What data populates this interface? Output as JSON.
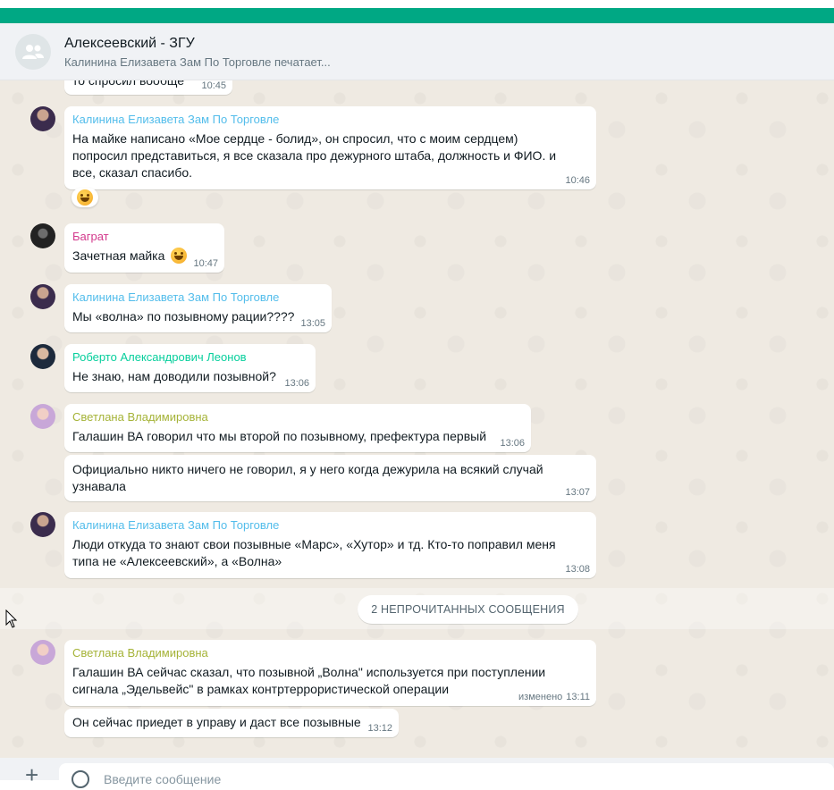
{
  "header": {
    "title": "Алексеевский - ЗГУ",
    "status": "Калинина Елизавета Зам По Торговле печатает..."
  },
  "colors": {
    "brand": "#00a884",
    "sender_kalinina": "#53bdeb",
    "sender_bagrat": "#d3398c",
    "sender_leonov": "#06cf9c",
    "sender_svetlana": "#a5b337"
  },
  "messages": [
    {
      "text": "то спросил вообще",
      "time": "10:45"
    },
    {
      "sender": "Калинина Елизавета Зам По Торговле",
      "text": "На майке написано «Мое сердце - болид», он спросил, что с моим сердцем) попросил представиться, я все сказала про дежурного штаба, должность и ФИО. и все, сказал спасибо.",
      "time": "10:46",
      "reaction": "face-with-tears-of-joy"
    },
    {
      "sender": "Баграт",
      "text": "Зачетная майка",
      "time": "10:47",
      "emoji": "grinning-face"
    },
    {
      "sender": "Калинина Елизавета Зам По Торговле",
      "text": "Мы «волна» по позывному рации????",
      "time": "13:05"
    },
    {
      "sender": "Роберто Александрович Леонов",
      "text": "Не знаю, нам доводили позывной?",
      "time": "13:06"
    },
    {
      "sender": "Светлана Владимировна",
      "text": "Галашин ВА говорил что мы второй по позывному, префектура первый",
      "time": "13:06"
    },
    {
      "text": "Официально никто ничего не говорил, я у него  когда дежурила на всякий случай узнавала",
      "time": "13:07"
    },
    {
      "sender": "Калинина Елизавета Зам По Торговле",
      "text": "Люди откуда то знают свои позывные «Марс», «Хутор» и тд. Кто-то поправил меня типа не «Алексеевский», а «Волна»",
      "time": "13:08"
    },
    {
      "sender": "Светлана Владимировна",
      "text": "Галашин ВА сейчас сказал, что позывной „Волна\" используется при поступлении сигнала „Эдельвейс\" в рамках контртеррористической операции",
      "time": "13:11",
      "edited": "изменено"
    },
    {
      "text": "Он сейчас приедет в управу и даст все позывные",
      "time": "13:12"
    }
  ],
  "unread_label": "2 НЕПРОЧИТАННЫХ СООБЩЕНИЯ",
  "composer": {
    "placeholder": "Введите сообщение"
  }
}
